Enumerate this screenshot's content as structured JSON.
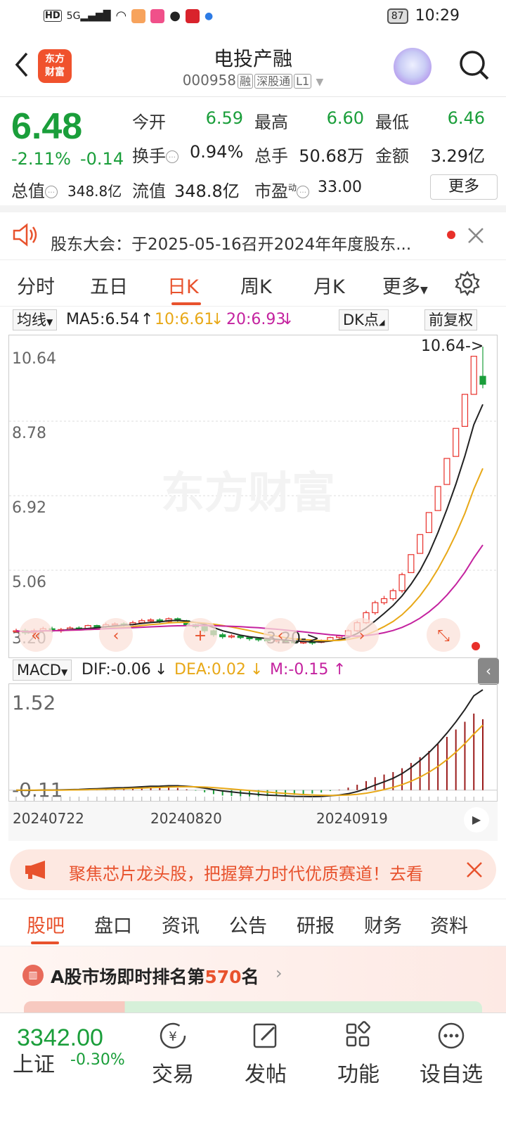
{
  "status": {
    "time": "10:29",
    "battery": "87"
  },
  "header": {
    "title": "电投产融",
    "code": "000958",
    "tags": [
      "融",
      "深股通",
      "L1"
    ],
    "logo_text": "东方\n财富"
  },
  "quote": {
    "price": "6.48",
    "change_pct": "-2.11%",
    "change": "-0.14",
    "open_label": "今开",
    "open": "6.59",
    "high_label": "最高",
    "high": "6.60",
    "low_label": "最低",
    "low": "6.46",
    "turnover_label": "换手",
    "turnover": "0.94%",
    "volume_label": "总手",
    "volume": "50.68万",
    "amount_label": "金额",
    "amount": "3.29亿",
    "mktcap_label": "总值",
    "mktcap": "348.8亿",
    "float_label": "流值",
    "float": "348.8亿",
    "pe_label": "市盈",
    "pe_sup": "动",
    "pe": "33.00",
    "more": "更多"
  },
  "notice": {
    "text": "股东大会：于2025-05-16召开2024年年度股东..."
  },
  "tabs": [
    "分时",
    "五日",
    "日K",
    "周K",
    "月K",
    "更多"
  ],
  "active_tab": 2,
  "chart": {
    "ma_select": "均线",
    "ma5": "MA5:6.54",
    "ma10": "10:6.61",
    "ma20": "20:6.93",
    "dk": "DK点",
    "adjust": "前复权",
    "y_labels": [
      "10.64",
      "8.78",
      "6.92",
      "5.06",
      "3.20"
    ],
    "max_label": "10.64->",
    "min_label": "3.20->",
    "watermark": "东方财富",
    "macd_select": "MACD",
    "dif": "DIF:-0.06",
    "dea": "DEA:0.02",
    "m": "M:-0.15",
    "macd_y": [
      "1.52",
      "-0.11"
    ],
    "dates": [
      "20240722",
      "20240820",
      "20240919"
    ]
  },
  "chart_data": {
    "type": "candlestick",
    "ylim": [
      3.2,
      10.64
    ],
    "candles": [
      [
        3.55,
        3.55,
        3.6,
        3.5
      ],
      [
        3.55,
        3.5,
        3.6,
        3.45
      ],
      [
        3.5,
        3.55,
        3.6,
        3.45
      ],
      [
        3.55,
        3.6,
        3.65,
        3.5
      ],
      [
        3.6,
        3.55,
        3.65,
        3.5
      ],
      [
        3.55,
        3.58,
        3.62,
        3.5
      ],
      [
        3.58,
        3.62,
        3.66,
        3.55
      ],
      [
        3.62,
        3.6,
        3.66,
        3.56
      ],
      [
        3.6,
        3.68,
        3.7,
        3.58
      ],
      [
        3.68,
        3.65,
        3.7,
        3.6
      ],
      [
        3.65,
        3.7,
        3.75,
        3.62
      ],
      [
        3.7,
        3.72,
        3.76,
        3.66
      ],
      [
        3.72,
        3.7,
        3.76,
        3.66
      ],
      [
        3.7,
        3.75,
        3.8,
        3.68
      ],
      [
        3.75,
        3.8,
        3.85,
        3.72
      ],
      [
        3.8,
        3.82,
        3.86,
        3.75
      ],
      [
        3.82,
        3.78,
        3.86,
        3.74
      ],
      [
        3.78,
        3.85,
        3.88,
        3.76
      ],
      [
        3.85,
        3.8,
        3.88,
        3.76
      ],
      [
        3.8,
        3.7,
        3.82,
        3.65
      ],
      [
        3.7,
        3.65,
        3.72,
        3.6
      ],
      [
        3.65,
        3.55,
        3.68,
        3.5
      ],
      [
        3.55,
        3.45,
        3.58,
        3.4
      ],
      [
        3.45,
        3.4,
        3.5,
        3.35
      ],
      [
        3.4,
        3.42,
        3.46,
        3.36
      ],
      [
        3.42,
        3.38,
        3.45,
        3.34
      ],
      [
        3.38,
        3.35,
        3.4,
        3.3
      ],
      [
        3.35,
        3.33,
        3.38,
        3.28
      ],
      [
        3.33,
        3.3,
        3.36,
        3.26
      ],
      [
        3.3,
        3.32,
        3.35,
        3.26
      ],
      [
        3.32,
        3.28,
        3.35,
        3.24
      ],
      [
        3.28,
        3.25,
        3.3,
        3.22
      ],
      [
        3.25,
        3.27,
        3.3,
        3.22
      ],
      [
        3.27,
        3.26,
        3.3,
        3.2
      ],
      [
        3.26,
        3.3,
        3.33,
        3.24
      ],
      [
        3.3,
        3.38,
        3.4,
        3.28
      ],
      [
        3.38,
        3.42,
        3.45,
        3.35
      ],
      [
        3.42,
        3.55,
        3.58,
        3.4
      ],
      [
        3.55,
        3.75,
        3.8,
        3.52
      ],
      [
        3.75,
        4.0,
        4.05,
        3.72
      ],
      [
        4.0,
        4.25,
        4.3,
        3.95
      ],
      [
        4.25,
        4.35,
        4.42,
        4.2
      ],
      [
        4.35,
        4.55,
        4.6,
        4.3
      ],
      [
        4.55,
        4.95,
        5.0,
        4.5
      ],
      [
        5.0,
        5.45,
        5.45,
        5.0
      ],
      [
        5.48,
        5.95,
        5.95,
        5.48
      ],
      [
        6.0,
        6.5,
        6.5,
        6.0
      ],
      [
        6.55,
        7.15,
        7.15,
        6.55
      ],
      [
        7.2,
        7.85,
        7.85,
        7.2
      ],
      [
        7.9,
        8.6,
        8.6,
        7.9
      ],
      [
        8.65,
        9.45,
        9.45,
        8.65
      ],
      [
        9.45,
        10.4,
        10.4,
        9.45
      ],
      [
        9.9,
        9.7,
        10.64,
        9.6
      ]
    ],
    "ma5_last": 6.54,
    "ma10_last": 6.61,
    "ma20_last": 6.93
  },
  "ad": {
    "text": "聚焦芯片龙头股，把握算力时代优质赛道！去看"
  },
  "section_tabs": [
    "股吧",
    "盘口",
    "资讯",
    "公告",
    "研报",
    "财务",
    "资料"
  ],
  "active_section": 0,
  "rank": {
    "prefix": "A股市场即时排名第",
    "num": "570",
    "suffix": "名"
  },
  "bottom": {
    "index_value": "3342.00",
    "index_name": "上证",
    "index_chg": "-0.30%",
    "nav": [
      "交易",
      "发帖",
      "功能",
      "设自选"
    ]
  },
  "colors": {
    "up": "#e8302a",
    "down": "#1a9e3a",
    "accent": "#e8522d",
    "ma5": "#222222",
    "ma10": "#e8a817",
    "ma20": "#c4229f"
  }
}
